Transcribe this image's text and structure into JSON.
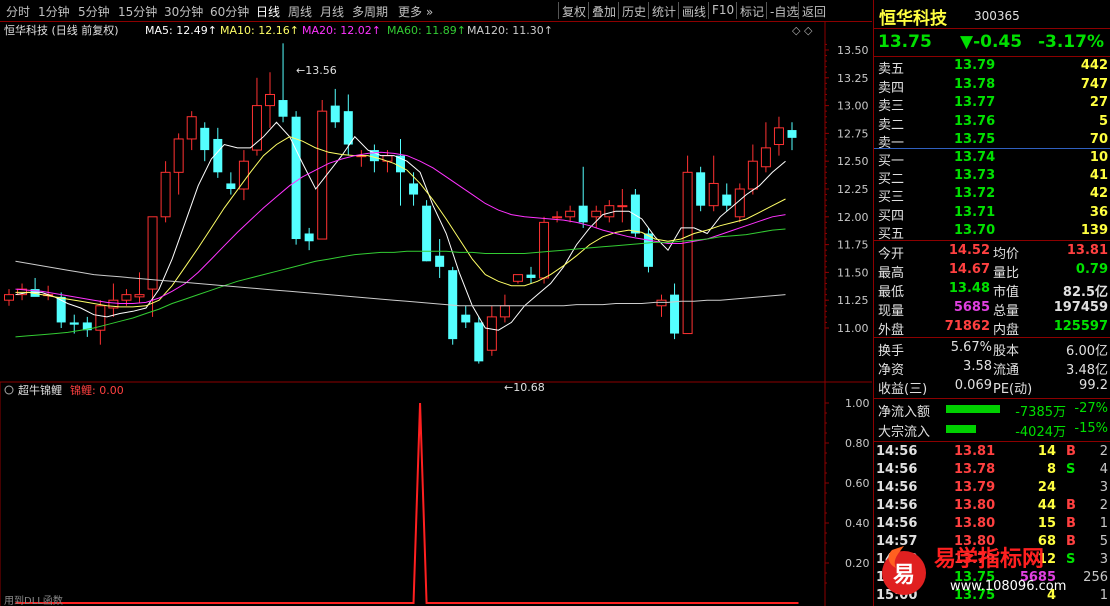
{
  "toolbar": {
    "periods": [
      "分时",
      "1分钟",
      "5分钟",
      "15分钟",
      "30分钟",
      "60分钟",
      "日线",
      "周线",
      "月线",
      "多周期",
      "更多"
    ],
    "active_period": "日线",
    "right_buttons": [
      "复权",
      "叠加",
      "历史",
      "统计",
      "画线",
      "F10",
      "标记",
      "-自选",
      "返回"
    ]
  },
  "main_chart": {
    "title": "恒华科技 (日线 前复权)",
    "ma_legend": [
      {
        "label": "MA5: 12.49",
        "color": "#ffffff"
      },
      {
        "label": "MA10: 12.16",
        "color": "#ffff66"
      },
      {
        "label": "MA20: 12.02",
        "color": "#ff33ff"
      },
      {
        "label": "MA60: 11.89",
        "color": "#33cc33"
      },
      {
        "label": "MA120: 11.30",
        "color": "#cccccc"
      }
    ],
    "y_ticks": [
      "13.50",
      "13.25",
      "13.00",
      "12.75",
      "12.50",
      "12.25",
      "12.00",
      "11.75",
      "11.50",
      "11.25",
      "11.00"
    ],
    "high_label": "13.56",
    "low_label": "10.68"
  },
  "indicator": {
    "name": "超牛锦鲤",
    "series_label": "锦鲤: 0.00",
    "y_ticks": [
      "1.00",
      "0.80",
      "0.60",
      "0.40",
      "0.20"
    ],
    "footer": "用到DLL函数"
  },
  "chart_data": [
    {
      "type": "candlestick",
      "title": "恒华科技 (日线 前复权)",
      "ylim": [
        10.6,
        13.7
      ],
      "candles": [
        [
          11.25,
          11.35,
          11.3,
          11.2
        ],
        [
          11.3,
          11.4,
          11.35,
          11.25
        ],
        [
          11.35,
          11.45,
          11.28,
          11.35
        ],
        [
          11.3,
          11.38,
          11.3,
          11.25
        ],
        [
          11.28,
          11.32,
          11.05,
          11.0
        ],
        [
          11.05,
          11.12,
          11.03,
          10.95
        ],
        [
          11.05,
          11.1,
          10.98,
          10.92
        ],
        [
          10.98,
          11.25,
          11.2,
          10.85
        ],
        [
          11.18,
          11.4,
          11.25,
          11.1
        ],
        [
          11.25,
          11.35,
          11.3,
          11.2
        ],
        [
          11.28,
          11.5,
          11.3,
          11.22
        ],
        [
          11.35,
          12.0,
          12.0,
          11.1
        ],
        [
          12.0,
          12.5,
          12.4,
          11.95
        ],
        [
          12.4,
          12.75,
          12.7,
          12.2
        ],
        [
          12.7,
          12.95,
          12.9,
          12.6
        ],
        [
          12.8,
          12.85,
          12.6,
          12.5
        ],
        [
          12.7,
          12.8,
          12.4,
          12.35
        ],
        [
          12.3,
          12.4,
          12.25,
          12.2
        ],
        [
          12.25,
          12.6,
          12.5,
          12.15
        ],
        [
          12.6,
          13.25,
          13.0,
          12.55
        ],
        [
          13.0,
          13.3,
          13.1,
          12.8
        ],
        [
          13.05,
          13.56,
          12.9,
          12.85
        ],
        [
          12.9,
          12.95,
          11.8,
          11.75
        ],
        [
          11.85,
          11.9,
          11.78,
          11.7
        ],
        [
          11.8,
          13.05,
          12.95,
          11.8
        ],
        [
          13.0,
          13.15,
          12.85,
          12.8
        ],
        [
          12.95,
          13.1,
          12.65,
          12.55
        ],
        [
          12.55,
          12.6,
          12.55,
          12.45
        ],
        [
          12.6,
          12.65,
          12.5,
          12.4
        ],
        [
          12.5,
          12.6,
          12.55,
          12.4
        ],
        [
          12.55,
          12.7,
          12.4,
          12.1
        ],
        [
          12.3,
          12.4,
          12.2,
          12.1
        ],
        [
          12.1,
          12.15,
          11.6,
          11.6
        ],
        [
          11.65,
          11.8,
          11.55,
          11.45
        ],
        [
          11.52,
          11.55,
          10.9,
          10.85
        ],
        [
          11.12,
          11.2,
          11.05,
          11.0
        ],
        [
          11.05,
          11.1,
          10.7,
          10.68
        ],
        [
          10.8,
          11.2,
          11.1,
          10.75
        ],
        [
          11.1,
          11.3,
          11.2,
          11.05
        ],
        [
          11.42,
          11.48,
          11.48,
          11.4
        ],
        [
          11.48,
          11.55,
          11.45,
          11.4
        ],
        [
          11.45,
          12.0,
          11.95,
          11.4
        ],
        [
          12.0,
          12.05,
          12.0,
          11.95
        ],
        [
          12.0,
          12.1,
          12.05,
          11.95
        ],
        [
          12.1,
          12.45,
          11.95,
          11.9
        ],
        [
          12.0,
          12.1,
          12.05,
          11.9
        ],
        [
          12.0,
          12.15,
          12.1,
          11.95
        ],
        [
          12.1,
          12.25,
          12.1,
          11.95
        ],
        [
          12.2,
          12.25,
          11.85,
          11.82
        ],
        [
          11.85,
          11.9,
          11.55,
          11.5
        ],
        [
          11.2,
          11.3,
          11.25,
          11.1
        ],
        [
          11.3,
          11.4,
          10.95,
          10.9
        ],
        [
          10.95,
          12.55,
          12.4,
          10.95
        ],
        [
          12.4,
          12.45,
          12.1,
          12.05
        ],
        [
          12.1,
          12.55,
          12.3,
          12.05
        ],
        [
          12.2,
          12.3,
          12.1,
          12.05
        ],
        [
          12.0,
          12.3,
          12.25,
          11.95
        ],
        [
          12.25,
          12.65,
          12.5,
          12.2
        ],
        [
          12.45,
          12.85,
          12.62,
          12.4
        ],
        [
          12.65,
          12.9,
          12.8,
          12.55
        ],
        [
          12.78,
          12.85,
          12.71,
          12.6
        ]
      ],
      "ma_lines": {
        "MA5": [
          11.3,
          11.32,
          11.32,
          11.28,
          11.22,
          11.18,
          11.12,
          11.1,
          11.13,
          11.15,
          11.18,
          11.35,
          11.62,
          11.95,
          12.28,
          12.52,
          12.65,
          12.62,
          12.62,
          12.72,
          12.85,
          12.72,
          12.48,
          12.25,
          12.4,
          12.55,
          12.72,
          12.6,
          12.55,
          12.55,
          12.5,
          12.4,
          12.1,
          11.85,
          11.5,
          11.2,
          11.0,
          10.98,
          11.05,
          11.2,
          11.3,
          11.4,
          11.55,
          11.75,
          11.9,
          12.02,
          12.05,
          12.05,
          11.98,
          11.82,
          11.7,
          11.9,
          11.9,
          11.85,
          12.0,
          12.1,
          12.2,
          12.28,
          12.4,
          12.5
        ],
        "MA10": [
          11.32,
          11.32,
          11.3,
          11.28,
          11.26,
          11.24,
          11.22,
          11.2,
          11.19,
          11.19,
          11.2,
          11.25,
          11.38,
          11.55,
          11.72,
          11.9,
          12.08,
          12.24,
          12.4,
          12.55,
          12.65,
          12.72,
          12.68,
          12.62,
          12.58,
          12.56,
          12.55,
          12.55,
          12.52,
          12.48,
          12.42,
          12.3,
          12.15,
          11.98,
          11.8,
          11.62,
          11.48,
          11.42,
          11.38,
          11.38,
          11.42,
          11.48,
          11.56,
          11.65,
          11.75,
          11.82,
          11.86,
          11.88,
          11.86,
          11.8,
          11.78,
          11.8,
          11.85,
          11.88,
          11.92,
          11.95,
          11.98,
          12.04,
          12.1,
          12.16
        ],
        "MA20": [
          11.35,
          11.34,
          11.33,
          11.31,
          11.29,
          11.27,
          11.25,
          11.23,
          11.22,
          11.22,
          11.23,
          11.27,
          11.33,
          11.4,
          11.5,
          11.62,
          11.74,
          11.86,
          11.97,
          12.08,
          12.18,
          12.28,
          12.36,
          12.42,
          12.48,
          12.52,
          12.55,
          12.57,
          12.58,
          12.57,
          12.55,
          12.5,
          12.44,
          12.36,
          12.28,
          12.2,
          12.12,
          12.06,
          12.02,
          12.0,
          11.99,
          11.98,
          11.97,
          11.95,
          11.92,
          11.88,
          11.85,
          11.82,
          11.8,
          11.78,
          11.76,
          11.76,
          11.78,
          11.8,
          11.84,
          11.88,
          11.92,
          11.96,
          12.0,
          12.02
        ],
        "MA60": [
          10.92,
          10.93,
          10.94,
          10.95,
          10.96,
          10.98,
          11.0,
          11.03,
          11.06,
          11.09,
          11.13,
          11.17,
          11.22,
          11.26,
          11.3,
          11.34,
          11.38,
          11.42,
          11.45,
          11.48,
          11.51,
          11.54,
          11.57,
          11.6,
          11.62,
          11.64,
          11.66,
          11.67,
          11.68,
          11.68,
          11.69,
          11.69,
          11.69,
          11.69,
          11.68,
          11.68,
          11.67,
          11.67,
          11.67,
          11.67,
          11.68,
          11.69,
          11.7,
          11.71,
          11.72,
          11.73,
          11.74,
          11.75,
          11.76,
          11.77,
          11.77,
          11.78,
          11.79,
          11.8,
          11.82,
          11.83,
          11.84,
          11.86,
          11.88,
          11.89
        ],
        "MA120": [
          11.6,
          11.58,
          11.56,
          11.54,
          11.52,
          11.5,
          11.48,
          11.47,
          11.46,
          11.45,
          11.44,
          11.43,
          11.42,
          11.41,
          11.4,
          11.39,
          11.38,
          11.37,
          11.36,
          11.35,
          11.34,
          11.33,
          11.32,
          11.31,
          11.3,
          11.29,
          11.28,
          11.27,
          11.26,
          11.25,
          11.24,
          11.23,
          11.22,
          11.21,
          11.2,
          11.2,
          11.2,
          11.2,
          11.2,
          11.2,
          11.2,
          11.2,
          11.2,
          11.21,
          11.21,
          11.21,
          11.22,
          11.22,
          11.22,
          11.23,
          11.23,
          11.24,
          11.24,
          11.25,
          11.25,
          11.26,
          11.27,
          11.28,
          11.29,
          11.3
        ]
      }
    },
    {
      "type": "line",
      "title": "超牛锦鲤",
      "ylim": [
        0,
        1.05
      ],
      "series": [
        {
          "name": "锦鲤",
          "values": [
            0,
            0,
            0,
            0,
            0,
            0,
            0,
            0,
            0,
            0,
            0,
            0,
            0,
            0,
            0,
            0,
            0,
            0,
            0,
            0,
            0,
            0,
            0,
            0,
            0,
            0,
            0,
            0,
            0,
            0,
            0,
            0,
            0,
            0,
            0,
            0,
            0,
            0,
            0,
            0,
            0,
            0,
            0,
            0,
            0,
            0,
            0,
            0,
            0,
            0,
            0,
            0,
            0,
            0,
            0,
            0,
            0,
            0,
            0,
            0,
            0,
            0
          ]
        }
      ],
      "spike_index": 31
    }
  ],
  "stock": {
    "name": "恒华科技",
    "code": "300365",
    "price": "13.75",
    "change": "▼-0.45",
    "change_pct": "-3.17%"
  },
  "asks": [
    {
      "label": "卖五",
      "price": "13.79",
      "vol": "442"
    },
    {
      "label": "卖四",
      "price": "13.78",
      "vol": "747"
    },
    {
      "label": "卖三",
      "price": "13.77",
      "vol": "27"
    },
    {
      "label": "卖二",
      "price": "13.76",
      "vol": "5"
    },
    {
      "label": "卖一",
      "price": "13.75",
      "vol": "70"
    }
  ],
  "bids": [
    {
      "label": "买一",
      "price": "13.74",
      "vol": "10"
    },
    {
      "label": "买二",
      "price": "13.73",
      "vol": "41"
    },
    {
      "label": "买三",
      "price": "13.72",
      "vol": "42"
    },
    {
      "label": "买四",
      "price": "13.71",
      "vol": "36"
    },
    {
      "label": "买五",
      "price": "13.70",
      "vol": "139"
    }
  ],
  "stats": [
    {
      "l1": "今开",
      "v1": "14.52",
      "c1": "#ff4040",
      "l2": "均价",
      "v2": "13.81",
      "c2": "#ff4040"
    },
    {
      "l1": "最高",
      "v1": "14.67",
      "c1": "#ff4040",
      "l2": "量比",
      "v2": "0.79",
      "c2": "#00e000"
    },
    {
      "l1": "最低",
      "v1": "13.48",
      "c1": "#00e000",
      "l2": "市值",
      "v2": "82.5亿",
      "c2": "#e0e0e0"
    },
    {
      "l1": "现量",
      "v1": "5685",
      "c1": "#e040e0",
      "l2": "总量",
      "v2": "197459",
      "c2": "#e0e0e0"
    },
    {
      "l1": "外盘",
      "v1": "71862",
      "c1": "#ff4040",
      "l2": "内盘",
      "v2": "125597",
      "c2": "#00e000"
    }
  ],
  "stats2": [
    {
      "l1": "换手",
      "v1": "5.67%",
      "l2": "股本",
      "v2": "6.00亿"
    },
    {
      "l1": "净资",
      "v1": "3.58",
      "l2": "流通",
      "v2": "3.48亿"
    },
    {
      "l1": "收益(三)",
      "v1": "0.069",
      "l2": "PE(动)",
      "v2": "99.2"
    }
  ],
  "flows": [
    {
      "label": "净流入额",
      "value": "-7385万",
      "pct": "-27%",
      "bar": 0.27
    },
    {
      "label": "大宗流入",
      "value": "-4024万",
      "pct": "-15%",
      "bar": 0.15
    }
  ],
  "ticks": [
    {
      "time": "14:56",
      "price": "13.81",
      "pc": "#ff4040",
      "vol": "14",
      "vc": "#ffff40",
      "bs": "B",
      "bc": "#ff4040",
      "n": "2"
    },
    {
      "time": "14:56",
      "price": "13.78",
      "pc": "#ff4040",
      "vol": "8",
      "vc": "#ffff40",
      "bs": "S",
      "bc": "#00e000",
      "n": "4"
    },
    {
      "time": "14:56",
      "price": "13.79",
      "pc": "#ff4040",
      "vol": "24",
      "vc": "#ffff40",
      "bs": "",
      "bc": "#ffffff",
      "n": "3"
    },
    {
      "time": "14:56",
      "price": "13.80",
      "pc": "#ff4040",
      "vol": "44",
      "vc": "#ffff40",
      "bs": "B",
      "bc": "#ff4040",
      "n": "2"
    },
    {
      "time": "14:56",
      "price": "13.80",
      "pc": "#ff4040",
      "vol": "15",
      "vc": "#ffff40",
      "bs": "B",
      "bc": "#ff4040",
      "n": "1"
    },
    {
      "time": "14:57",
      "price": "13.80",
      "pc": "#ff4040",
      "vol": "68",
      "vc": "#ffff40",
      "bs": "B",
      "bc": "#ff4040",
      "n": "5"
    },
    {
      "time": "14:58",
      "price": "13.79",
      "pc": "#ff4040",
      "vol": "12",
      "vc": "#ffff40",
      "bs": "S",
      "bc": "#00e000",
      "n": "3"
    },
    {
      "time": "15:00",
      "price": "13.75",
      "pc": "#00e000",
      "vol": "5685",
      "vc": "#e040e0",
      "bs": "",
      "bc": "#ffffff",
      "n": "256"
    },
    {
      "time": "15:00",
      "price": "13.75",
      "pc": "#00e000",
      "vol": "4",
      "vc": "#ffff40",
      "bs": "",
      "bc": "#ffffff",
      "n": "1"
    }
  ],
  "watermark": {
    "logo_char": "易",
    "title": "易学指标网",
    "url": "www.108096.com"
  }
}
